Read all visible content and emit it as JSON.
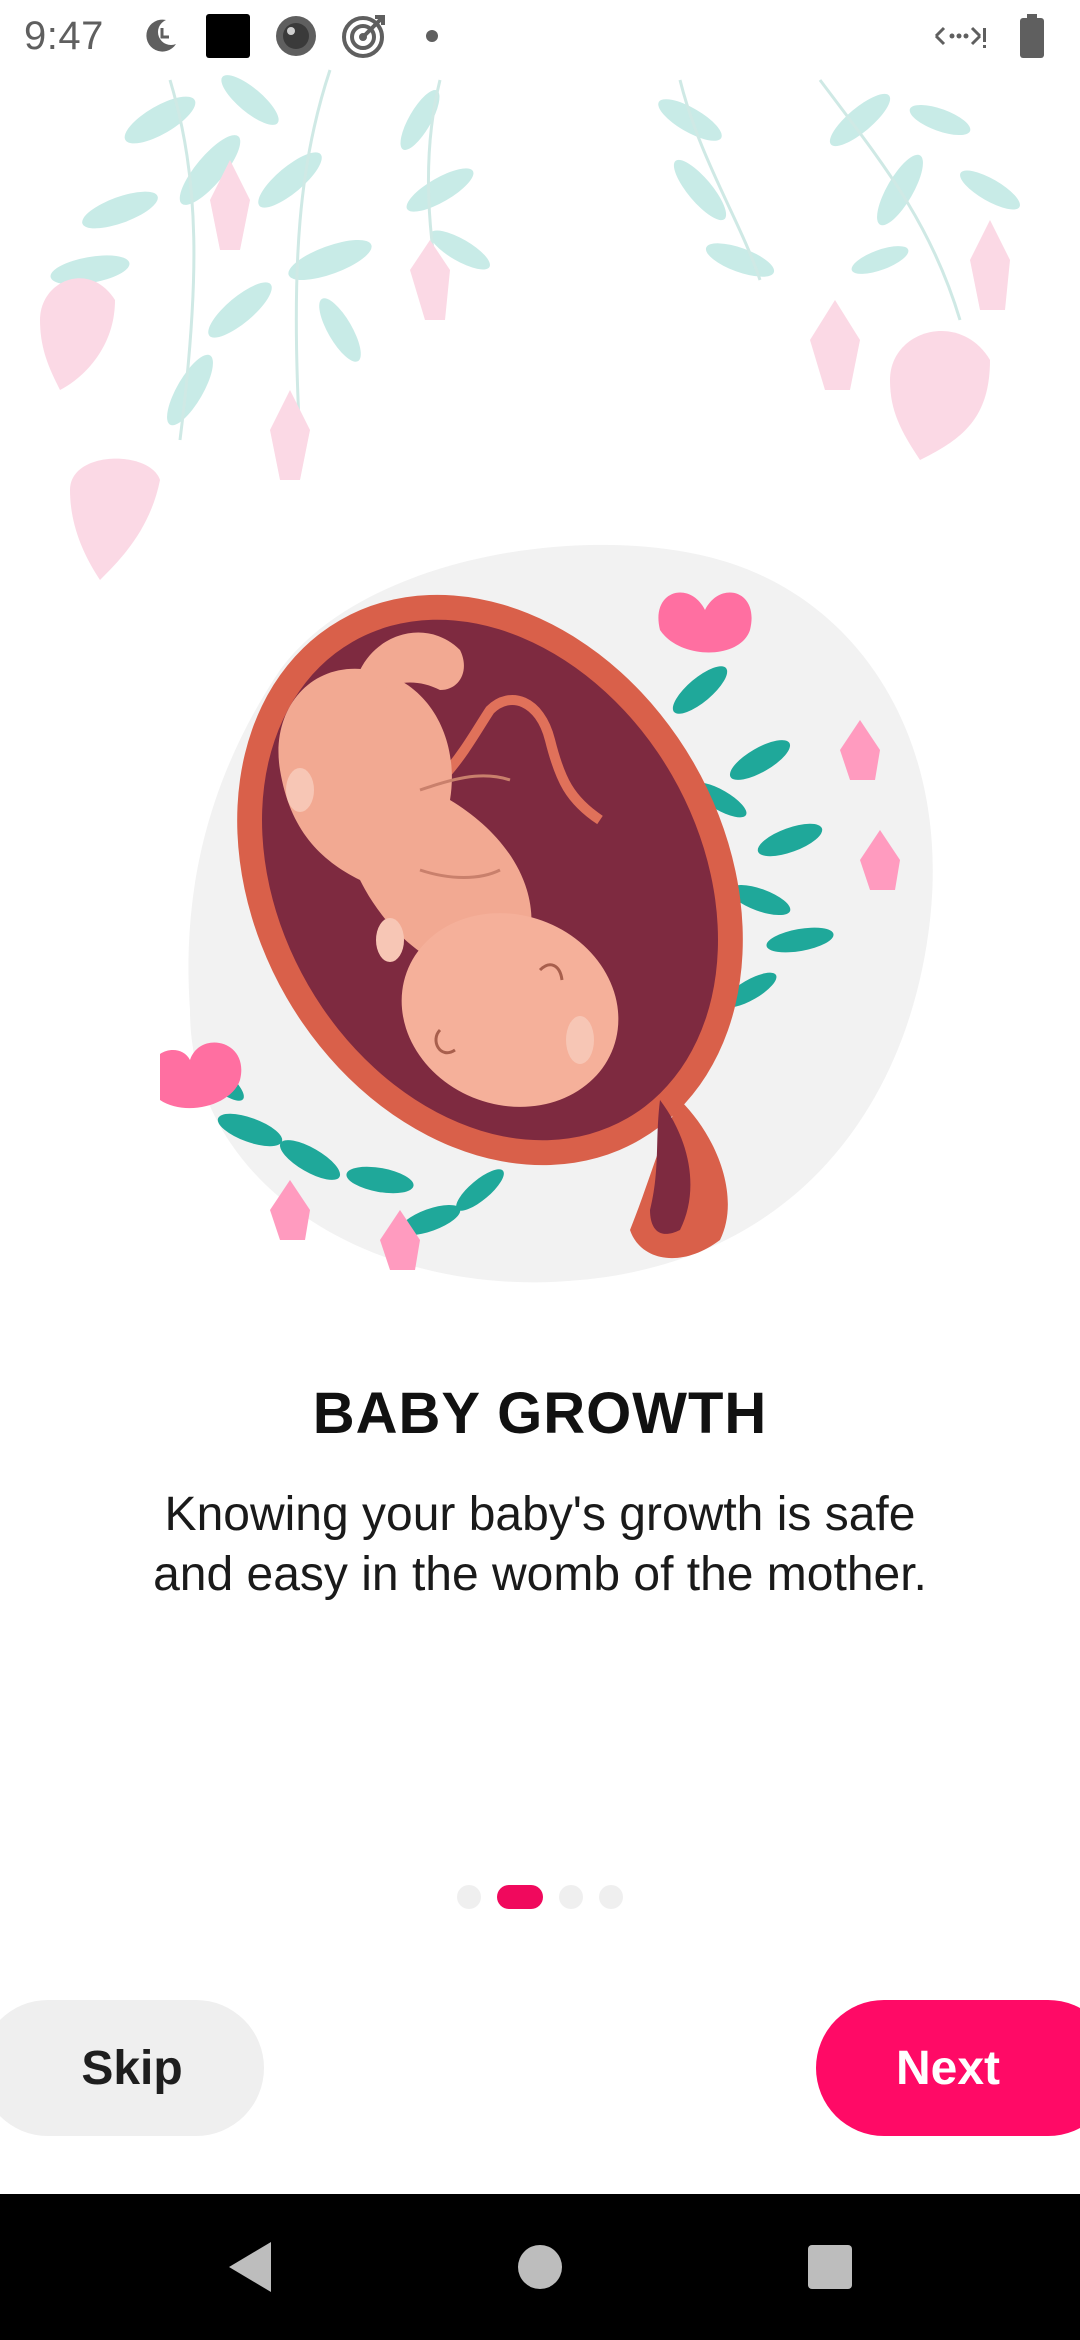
{
  "status_bar": {
    "time": "9:47",
    "left_icons": [
      "do-not-disturb-icon",
      "app-square-icon",
      "camera-lens-icon",
      "target-icon",
      "dot-icon"
    ],
    "right_icons": [
      "data-arrows-icon",
      "battery-icon"
    ]
  },
  "onboarding": {
    "title": "BABY GROWTH",
    "description_line1": "Knowing your baby's growth is safe",
    "description_line2": "and easy in the womb of the mother.",
    "page_count": 4,
    "current_page": 2
  },
  "buttons": {
    "skip_label": "Skip",
    "next_label": "Next"
  },
  "navigation": {
    "icons": [
      "back-triangle-icon",
      "home-circle-icon",
      "recents-square-icon"
    ]
  },
  "colors": {
    "accent": "#ff0a66",
    "indicator_active": "#f0095d",
    "indicator_inactive": "#efefef",
    "skip_bg": "#efefef",
    "nav_bg": "#000000"
  }
}
